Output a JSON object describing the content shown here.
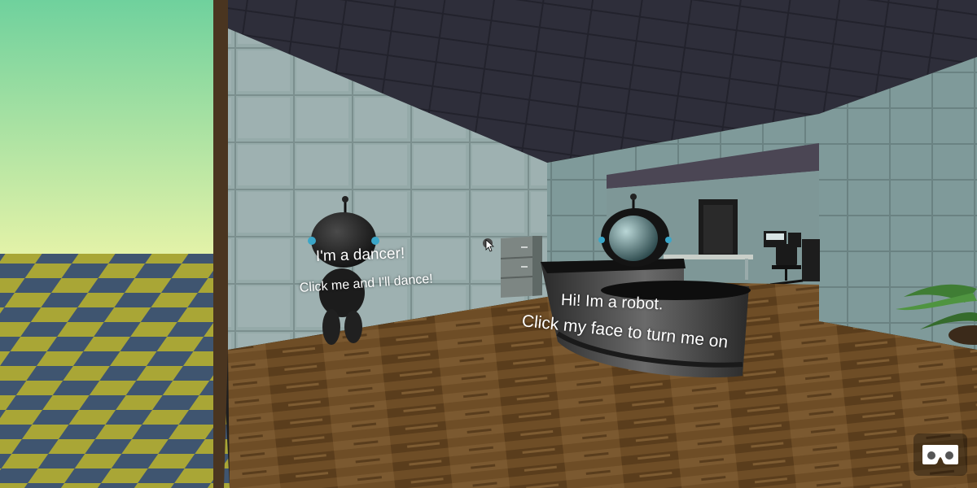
{
  "scene": {
    "dancer_robot": {
      "title": "I'm a dancer!",
      "hint": "Click me and I'll dance!"
    },
    "reception_robot": {
      "title": "Hi! Im a robot.",
      "hint": "Click my face to turn me on"
    }
  },
  "controls": {
    "vr_button_icon": "vr-goggles-icon",
    "cursor_icon": "mouse-pointer-icon"
  },
  "colors": {
    "sky_top": "#6fd19d",
    "sky_bottom": "#e6f3a8",
    "ground_blue": "#3f5570",
    "ground_yellow": "#a9a636",
    "wall": "#95aaa9",
    "ceiling": "#2b2b36",
    "floor": "#6b4b24"
  }
}
